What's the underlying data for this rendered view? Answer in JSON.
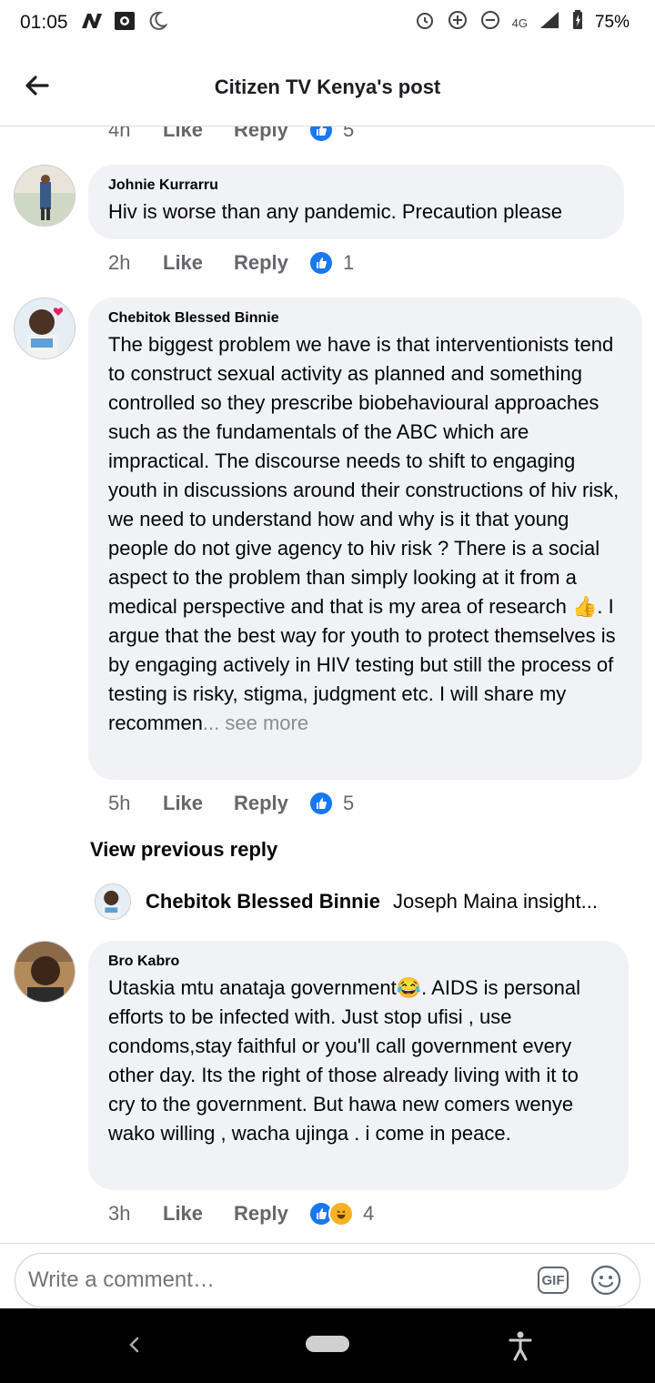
{
  "status_bar": {
    "time": "01:05",
    "battery": "75%",
    "network": "4G",
    "icons_left": [
      "n-icon",
      "photo-icon",
      "moon-icon"
    ],
    "icons_right": [
      "alarm-icon",
      "data-saver-icon",
      "dnd-icon",
      "network-icon",
      "signal-icon",
      "battery-icon"
    ]
  },
  "header": {
    "title": "Citizen TV Kenya's post"
  },
  "top_partial_actions": {
    "time": "4h",
    "like": "Like",
    "reply": "Reply",
    "count": "5"
  },
  "comments": [
    {
      "author": "Johnie Kurrarru",
      "text": "Hiv is worse than any pandemic. Precaution please",
      "time": "2h",
      "like": "Like",
      "reply": "Reply",
      "reaction_count": "1",
      "reactions": [
        "like"
      ]
    },
    {
      "author": "Chebitok Blessed Binnie",
      "text": "The biggest problem we have is that interventionists tend to construct sexual activity as planned and something controlled so they prescribe biobehavioural approaches such as the fundamentals of the ABC which are impractical. The discourse needs to shift to engaging youth in discussions around their constructions of hiv risk, we need to understand how and why is it that young people do not give agency to hiv risk ? There is a social aspect to the problem than simply looking at it from a medical perspective and that is my area of research",
      "text_after_emoji": ". I argue that the best way for youth to protect themselves is by engaging actively in HIV testing but still the process of testing is risky, stigma, judgment etc. I will share my recommen",
      "see_more": "... see more",
      "time": "5h",
      "like": "Like",
      "reply": "Reply",
      "reaction_count": "5",
      "reactions": [
        "like"
      ]
    },
    {
      "author": "Bro Kabro",
      "text_before_emoji": "Utaskia mtu anataja government",
      "text": ". AIDS is personal efforts to be infected with. Just stop ufisi , use condoms,stay faithful or you'll call government every other day. Its the right of those already living with it to cry to the government. But hawa new comers wenye wako willing , wacha ujinga . i come in peace.",
      "time": "3h",
      "like": "Like",
      "reply": "Reply",
      "reaction_count": "4",
      "reactions": [
        "like",
        "haha"
      ]
    }
  ],
  "view_previous_reply": "View previous reply",
  "reply_preview": {
    "author": "Chebitok Blessed Binnie",
    "snippet": "Joseph Maina insight..."
  },
  "composer": {
    "placeholder": "Write a comment…",
    "gif_label": "GIF"
  },
  "colors": {
    "like_blue": "#1877f2",
    "bubble_bg": "#f0f2f5",
    "meta_gray": "#65676b",
    "haha_yellow": "#f7b125"
  }
}
